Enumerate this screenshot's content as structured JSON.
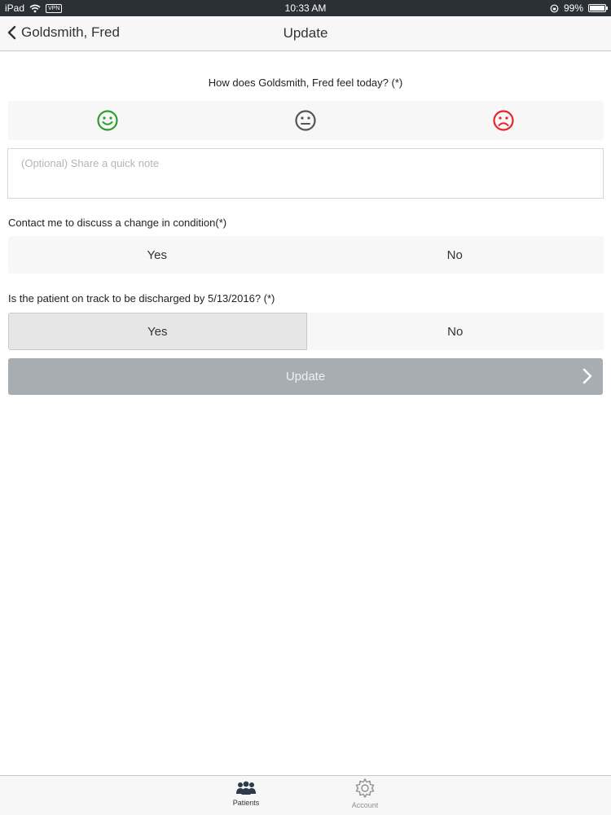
{
  "status_bar": {
    "device": "iPad",
    "vpn": "VPN",
    "time": "10:33 AM",
    "battery": "99%",
    "battery_level": 0.99
  },
  "nav": {
    "back_label": "Goldsmith, Fred",
    "title": "Update"
  },
  "form": {
    "mood_question": "How does Goldsmith, Fred feel today? (*)",
    "moods": [
      {
        "icon": "happy-face-icon",
        "color": "#2e9e2e"
      },
      {
        "icon": "neutral-face-icon",
        "color": "#555555"
      },
      {
        "icon": "sad-face-icon",
        "color": "#e8232a"
      }
    ],
    "note_placeholder": "(Optional) Share a quick note",
    "contact_question": "Contact me to discuss a change in condition(*)",
    "contact_options": [
      "Yes",
      "No"
    ],
    "discharge_question": "Is the patient on track to be discharged by 5/13/2016? (*)",
    "discharge_options": [
      "Yes",
      "No"
    ],
    "discharge_selected": "Yes",
    "submit_label": "Update"
  },
  "tab_bar": {
    "tabs": [
      {
        "label": "Patients",
        "icon": "patients-icon",
        "active": true
      },
      {
        "label": "Account",
        "icon": "gear-icon",
        "active": false
      }
    ]
  }
}
